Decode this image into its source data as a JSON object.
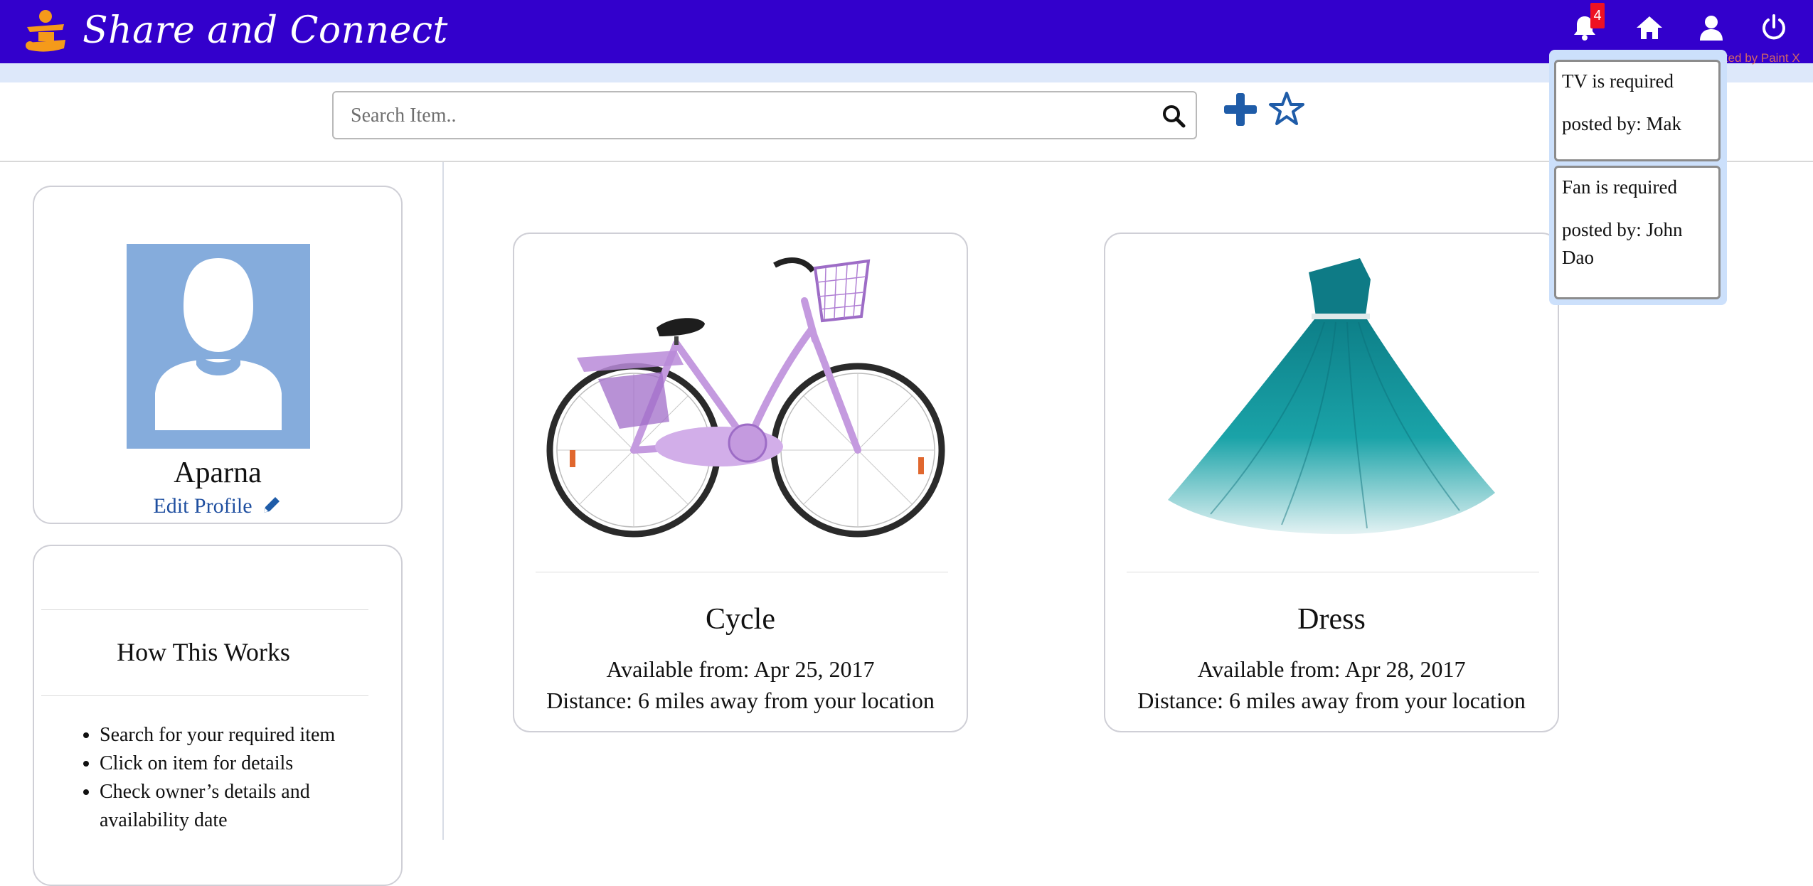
{
  "app": {
    "brand": "Share and Connect",
    "watermark": "Created by Paint X",
    "brand_color": "#3300cc",
    "accent_color": "#1f5ca8",
    "logo_color": "#f59a1a"
  },
  "navbar": {
    "notification_count": "4",
    "icons": [
      "bell-icon",
      "home-icon",
      "user-icon",
      "power-icon"
    ]
  },
  "search": {
    "placeholder": "Search Item..",
    "value": ""
  },
  "toolbar": {
    "icons": [
      "plus-icon",
      "star-icon"
    ]
  },
  "notifications": [
    {
      "line1": "TV is required",
      "line2": "posted by: Mak"
    },
    {
      "line1": "Fan is required",
      "line2": "posted by: John Dao"
    }
  ],
  "profile": {
    "name": "Aparna",
    "edit_label": "Edit Profile"
  },
  "how_it_works": {
    "title": "How This Works",
    "steps": [
      "Search for your required item",
      "Click on item for details",
      "Check owner’s details and availability date"
    ]
  },
  "items": [
    {
      "title": "Cycle",
      "available": "Available from: Apr 25, 2017",
      "distance": "Distance: 6 miles away from your location"
    },
    {
      "title": "Dress",
      "available": "Available from: Apr 28, 2017",
      "distance": "Distance: 6 miles away from your location"
    }
  ]
}
